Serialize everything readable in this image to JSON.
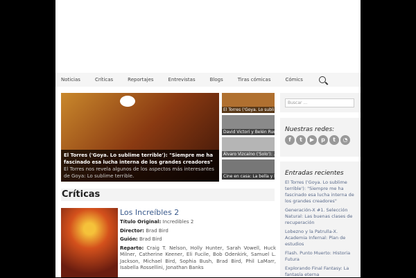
{
  "nav": {
    "items": [
      "Noticias",
      "Críticas",
      "Reportajes",
      "Entrevistas",
      "Blogs",
      "Tiras cómicas",
      "Cómics"
    ]
  },
  "slider": {
    "title": "El Torres ('Goya. Lo sublime terrible'): \"Siempre me ha fascinado esa lucha interna de los grandes creadores\"",
    "desc": "El Torres nos revela algunos de los aspectos más interesantes de Goya: Lo sublime terrible.",
    "thumbs": [
      "El Torres ('Goya. Lo subli...",
      "David Victori y Belén Rue...",
      "Álvaro Vizcaíno ('Solo'): ...",
      "Cine en casa: La bella y l..."
    ]
  },
  "sidebar": {
    "search_placeholder": "Buscar ...",
    "social_title": "Nuestras redes:",
    "social": [
      "f",
      "t",
      "yt",
      "p",
      "t",
      "rss"
    ],
    "recent_title": "Entradas recientes",
    "recent": [
      "El Torres ('Goya. Lo sublime terrible'): \"Siempre me ha fascinado esa lucha interna de los grandes creadores\"",
      "Generación-X #1. Selección Natural: Las buenas clases de recuperación",
      "Lobezno y la Patrulla-X. Academia Infernal: Plan de estudios",
      "Flash. Punto Muerto: Historia Futura",
      "Explorando Final Fantasy: La fantasía eterna"
    ]
  },
  "section": {
    "title": "Críticas"
  },
  "review": {
    "title": "Los Increíbles 2",
    "orig_label": "Título Original:",
    "orig": " Incredibles 2",
    "dir_label": "Director:",
    "dir": " Brad Bird",
    "gui_label": "Guión:",
    "gui": " Brad Bird",
    "rep_label": "Reparto:",
    "rep": " Craig T. Nelson, Holly Hunter, Sarah Vowell, Huck Milner, Catherine Keener, Eli Fucile, Bob Odenkirk, Samuel L. Jackson, Michael Bird, Sophia Bush, Brad Bird, Phil LaMarr, Isabella Rossellini, Jonathan Banks"
  }
}
